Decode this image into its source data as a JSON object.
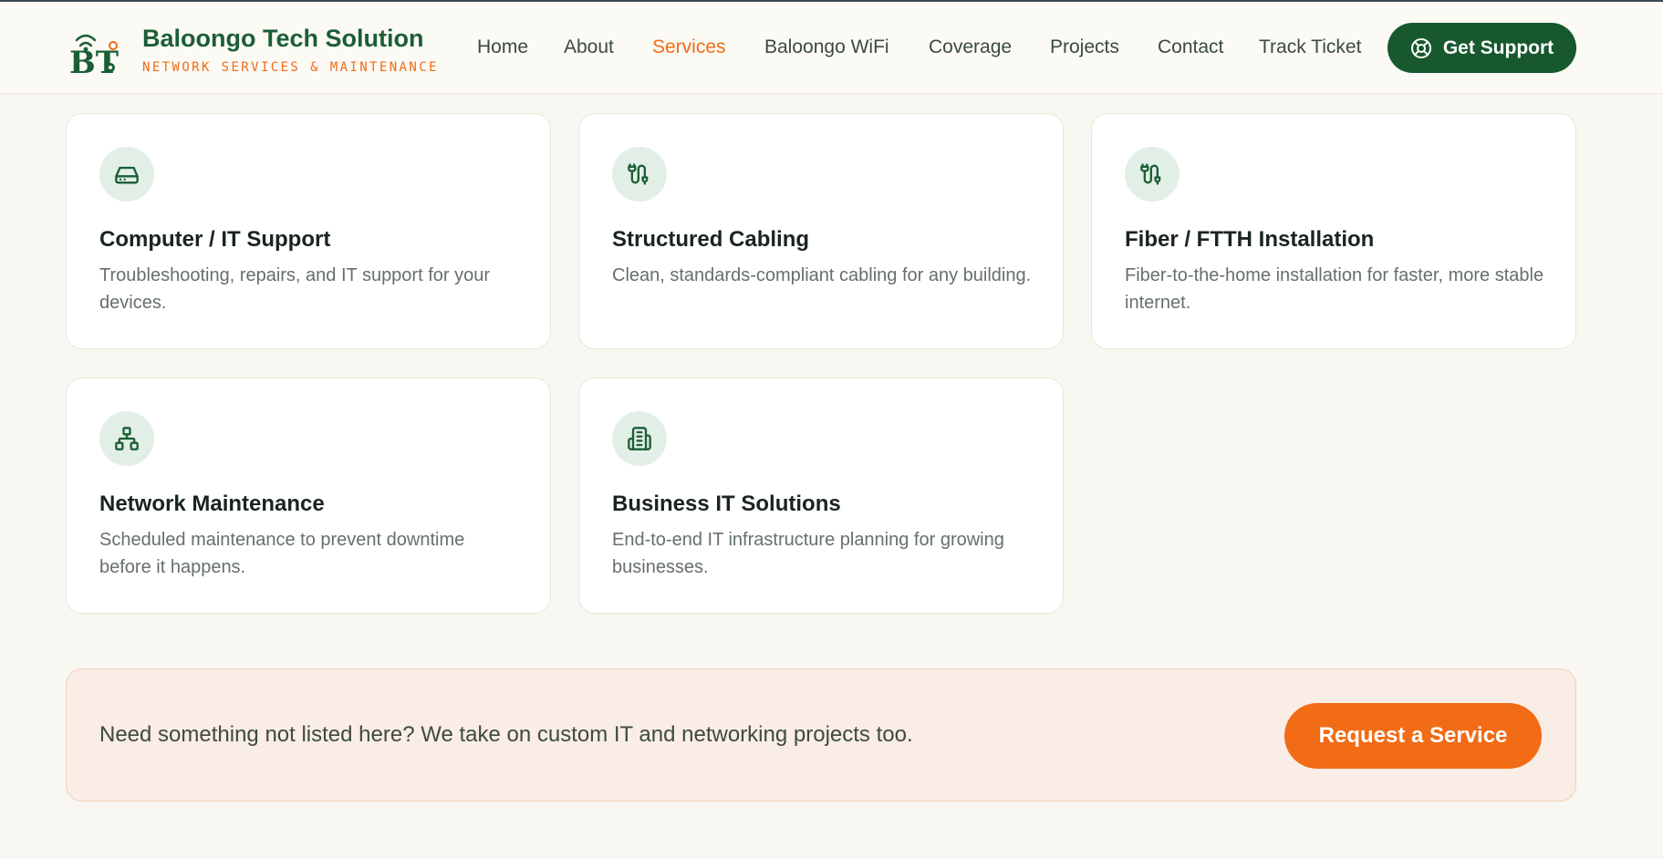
{
  "header": {
    "brand_title": "Baloongo Tech Solution",
    "brand_tagline": "NETWORK SERVICES & MAINTENANCE",
    "logo_text": "BT",
    "nav": [
      {
        "label": "Home"
      },
      {
        "label": "About"
      },
      {
        "label": "Services"
      },
      {
        "label": "Baloongo WiFi"
      },
      {
        "label": "Coverage"
      },
      {
        "label": "Projects"
      },
      {
        "label": "Contact"
      },
      {
        "label": "Track Ticket"
      }
    ],
    "active_nav": "Services",
    "support_button": "Get Support",
    "support_icon": "lifebuoy-icon"
  },
  "services": [
    {
      "icon": "hard-drive-icon",
      "title": "Computer / IT Support",
      "description": "Troubleshooting, repairs, and IT support for your devices."
    },
    {
      "icon": "cable-icon",
      "title": "Structured Cabling",
      "description": "Clean, standards-compliant cabling for any building."
    },
    {
      "icon": "cable-icon",
      "title": "Fiber / FTTH Installation",
      "description": "Fiber-to-the-home installation for faster, more stable internet."
    },
    {
      "icon": "network-icon",
      "title": "Network Maintenance",
      "description": "Scheduled maintenance to prevent downtime before it happens."
    },
    {
      "icon": "building-icon",
      "title": "Business IT Solutions",
      "description": "End-to-end IT infrastructure planning for growing businesses."
    }
  ],
  "cta": {
    "text": "Need something not listed here? We take on custom IT and networking projects too.",
    "button": "Request a Service"
  },
  "colors": {
    "brand_green": "#1b5e36",
    "accent_orange": "#f26b15",
    "icon_bg": "#e2efe6",
    "page_bg": "#f9f7f2"
  }
}
